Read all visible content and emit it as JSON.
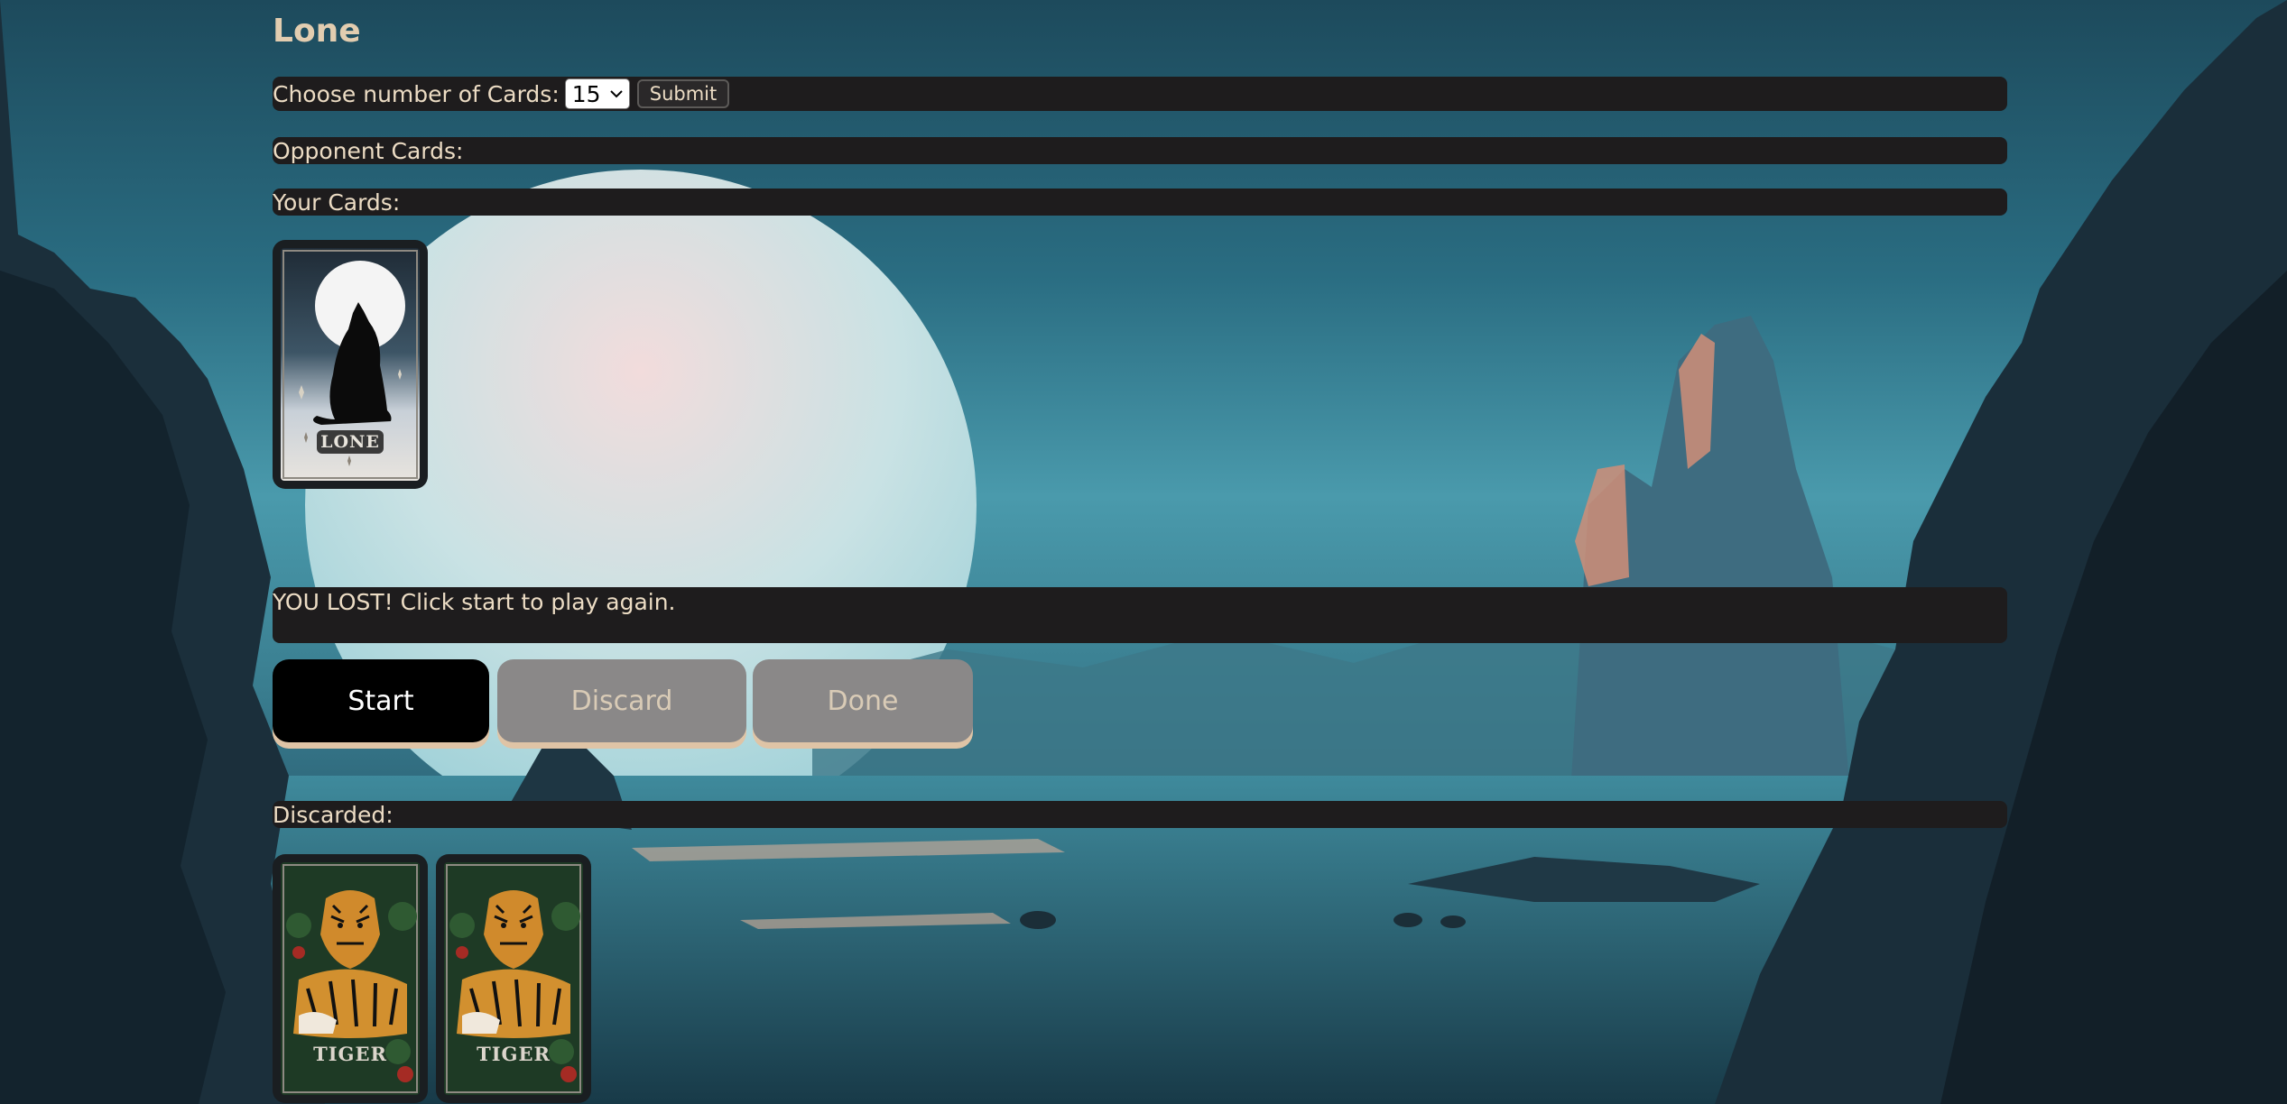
{
  "header": {
    "title": "Lone"
  },
  "setup": {
    "choose_label": "Choose number of Cards:",
    "card_count": "15",
    "submit_label": "Submit"
  },
  "opponent": {
    "label": "Opponent Cards:"
  },
  "player": {
    "label": "Your Cards:",
    "cards": [
      {
        "name": "LONE",
        "icon": "wolf-moon-icon"
      }
    ]
  },
  "status": {
    "message": "YOU LOST! Click start to play again."
  },
  "controls": {
    "start_label": "Start",
    "discard_label": "Discard",
    "done_label": "Done"
  },
  "discarded": {
    "label": "Discarded:",
    "cards": [
      {
        "name": "TIGER",
        "icon": "tiger-icon"
      },
      {
        "name": "TIGER",
        "icon": "tiger-icon"
      }
    ]
  },
  "colors": {
    "bar_bg": "#1e1c1d",
    "text": "#ecdcc4",
    "start_bg": "#000000",
    "disabled_bg": "#8a8888",
    "button_shadow": "#dfc4a6"
  }
}
